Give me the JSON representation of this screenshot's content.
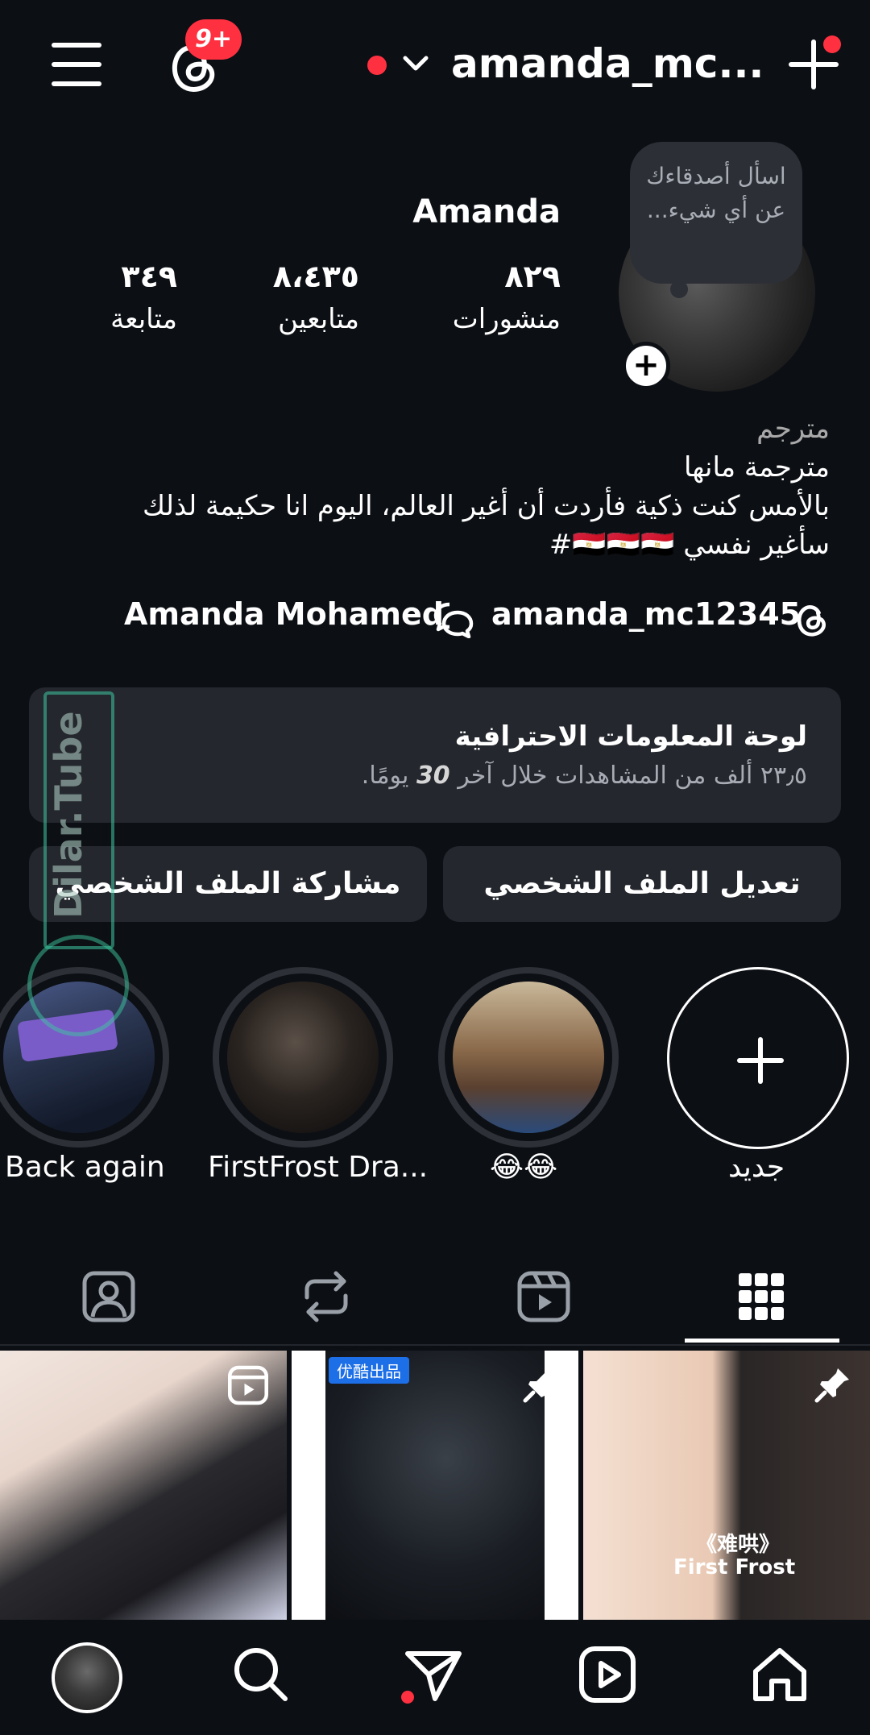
{
  "status": {
    "notification_badge": "9+"
  },
  "header": {
    "username": "amanda_mc..."
  },
  "profile": {
    "note": "اسأل أصدقاءك عن أي شيء...",
    "display_name": "Amanda",
    "stats": [
      {
        "value": "٨٢٩",
        "label": "منشورات"
      },
      {
        "value": "٨،٤٣٥",
        "label": "متابعين"
      },
      {
        "value": "٣٤٩",
        "label": "متابعة"
      }
    ],
    "category": "مترجم",
    "bio_lines": [
      "مترجمة مانها",
      "بالأمس كنت ذكية فأردت أن أغير العالم، اليوم انا حكيمة لذلك",
      "سأغير نفسي 🇪🇬🇪🇬🇪🇬#"
    ],
    "threads_handle": "amanda_mc12345",
    "linked_name": "Amanda Mohamed"
  },
  "dashboard": {
    "title": "لوحة المعلومات الاحترافية",
    "subtitle_prefix": "٢٣٫٥ ألف من المشاهدات خلال آخر",
    "subtitle_number": "30",
    "subtitle_suffix": "يومًا."
  },
  "buttons": {
    "edit_profile": "تعديل الملف الشخصي",
    "share_profile": "مشاركة الملف الشخصي"
  },
  "highlights": [
    {
      "label": "Back again"
    },
    {
      "label": "FirstFrost Dra..."
    },
    {
      "label": "😂😂"
    },
    {
      "label": "جديد"
    }
  ],
  "grid": {
    "post3_title_cn": "《难哄》",
    "post3_title_en": "First Frost",
    "post2_tag": "优酷出品"
  },
  "watermark": "Dilar.Tube",
  "colors": {
    "background": "#0c0f14",
    "surface": "#24272e",
    "accent": "#ff3040"
  }
}
